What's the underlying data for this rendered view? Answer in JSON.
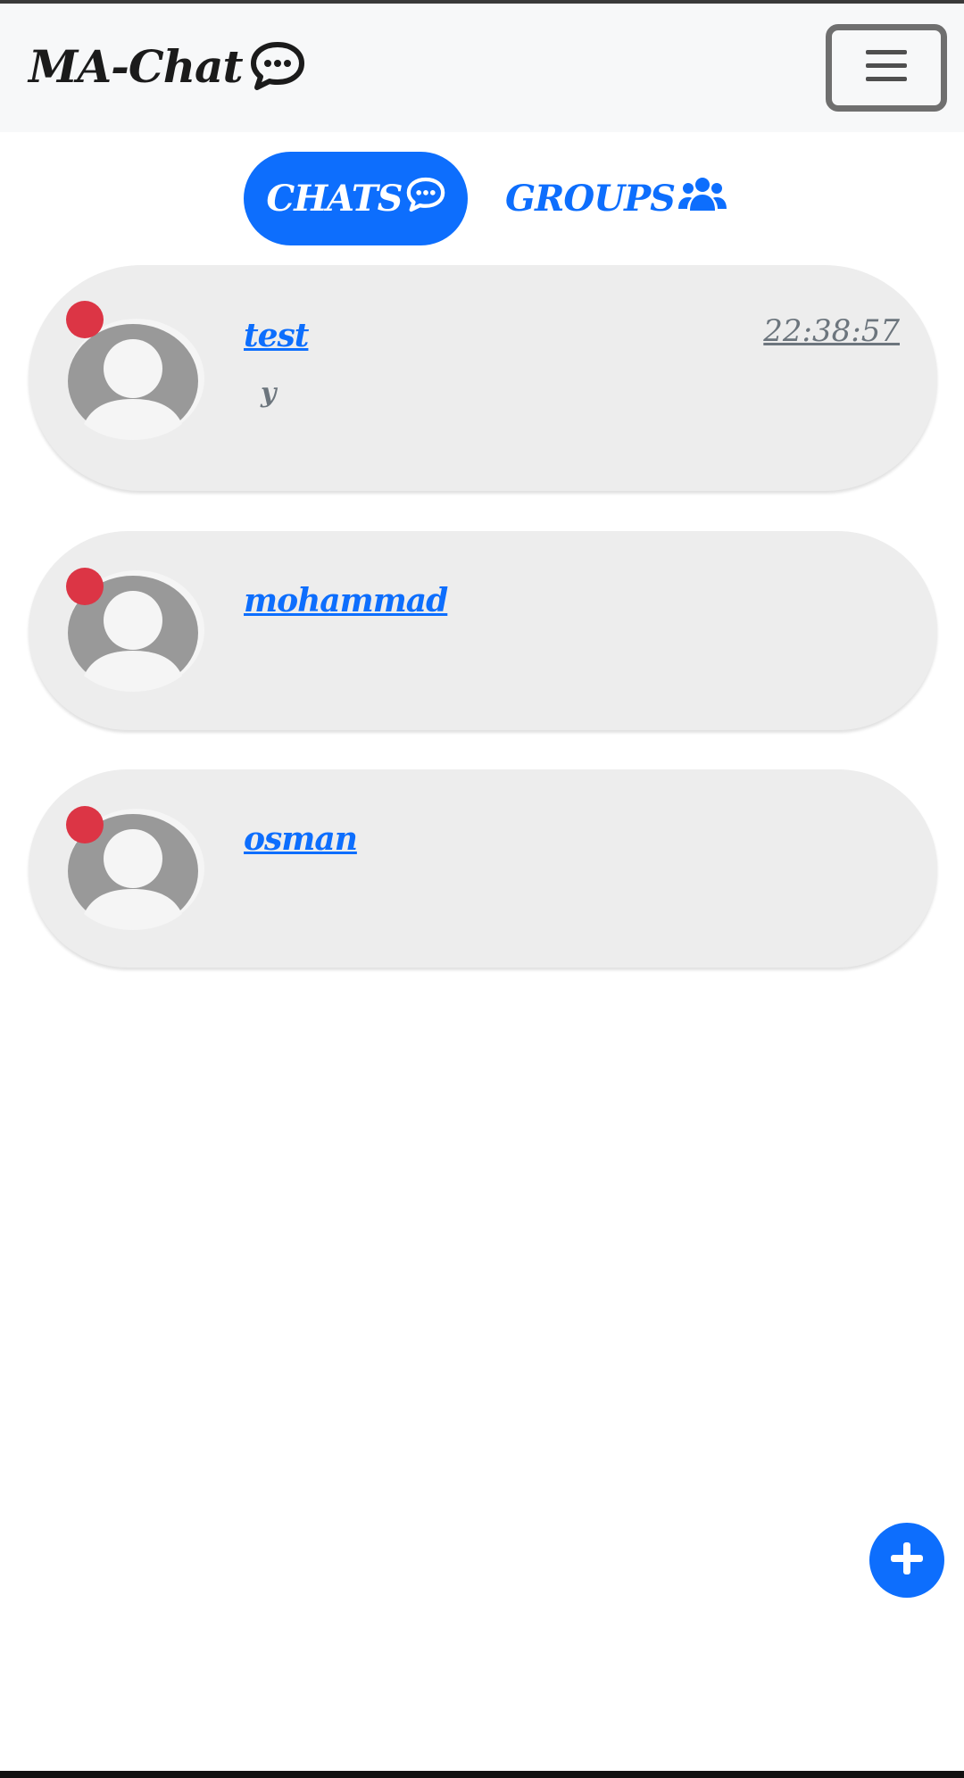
{
  "app": {
    "title": "MA-Chat",
    "brand_icon": "chat-bubble-icon"
  },
  "navbar": {
    "menu_icon": "hamburger-icon"
  },
  "tabs": [
    {
      "label": "CHATS",
      "icon": "chat-bubble-icon",
      "active": true
    },
    {
      "label": "GROUPS",
      "icon": "users-icon",
      "active": false
    }
  ],
  "chats": [
    {
      "name": "test",
      "last_message": "y",
      "time": "22:38:57",
      "status": "offline"
    },
    {
      "name": "mohammad",
      "last_message": "",
      "time": "",
      "status": "offline"
    },
    {
      "name": "osman",
      "last_message": "",
      "time": "",
      "status": "offline"
    }
  ],
  "fab": {
    "icon": "plus-icon"
  },
  "colors": {
    "accent": "#0d6efd",
    "status_offline": "#dc3545",
    "card_bg": "#ededed",
    "muted": "#6c757d"
  }
}
